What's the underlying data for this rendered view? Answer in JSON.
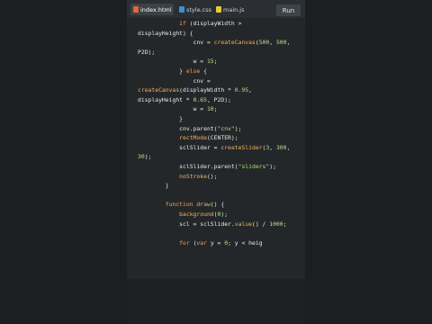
{
  "tabs": [
    {
      "label": "index.html",
      "icon": "html-file-icon",
      "active": true
    },
    {
      "label": "style.css",
      "icon": "css-file-icon",
      "active": false
    },
    {
      "label": "main.js",
      "icon": "js-file-icon",
      "active": false
    }
  ],
  "run_label": "Run",
  "code_lines": [
    [
      {
        "t": "            "
      },
      {
        "t": "if",
        "c": "kw"
      },
      {
        "t": " (displayWidth >"
      }
    ],
    [
      {
        "t": "displayHeight) {"
      }
    ],
    [
      {
        "t": "                "
      },
      {
        "t": "cnv = "
      },
      {
        "t": "createCanvas",
        "c": "fn"
      },
      {
        "t": "("
      },
      {
        "t": "500",
        "c": "num"
      },
      {
        "t": ", "
      },
      {
        "t": "500",
        "c": "num"
      },
      {
        "t": ","
      }
    ],
    [
      {
        "t": "P2D);"
      }
    ],
    [
      {
        "t": "                "
      },
      {
        "t": "w = "
      },
      {
        "t": "15",
        "c": "num"
      },
      {
        "t": ";"
      }
    ],
    [
      {
        "t": "            "
      },
      {
        "t": "} "
      },
      {
        "t": "else",
        "c": "kw"
      },
      {
        "t": " {"
      }
    ],
    [
      {
        "t": "                "
      },
      {
        "t": "cnv ="
      }
    ],
    [
      {
        "t": "createCanvas",
        "c": "fn"
      },
      {
        "t": "(displayWidth * "
      },
      {
        "t": "0.95",
        "c": "num"
      },
      {
        "t": ","
      }
    ],
    [
      {
        "t": "displayHeight * "
      },
      {
        "t": "0.65",
        "c": "num"
      },
      {
        "t": ", P2D);"
      }
    ],
    [
      {
        "t": "                "
      },
      {
        "t": "w = "
      },
      {
        "t": "10",
        "c": "num"
      },
      {
        "t": ";"
      }
    ],
    [
      {
        "t": "            "
      },
      {
        "t": "}"
      }
    ],
    [
      {
        "t": "            "
      },
      {
        "t": "cnv.parent("
      },
      {
        "t": "\"cnv\"",
        "c": "str"
      },
      {
        "t": ");"
      }
    ],
    [
      {
        "t": "            "
      },
      {
        "t": "rectMode",
        "c": "fn"
      },
      {
        "t": "(CENTER);"
      }
    ],
    [
      {
        "t": "            "
      },
      {
        "t": "sclSlider = "
      },
      {
        "t": "createSlider",
        "c": "fn"
      },
      {
        "t": "("
      },
      {
        "t": "3",
        "c": "num"
      },
      {
        "t": ", "
      },
      {
        "t": "300",
        "c": "num"
      },
      {
        "t": ","
      }
    ],
    [
      {
        "t": "30",
        "c": "num"
      },
      {
        "t": ");"
      }
    ],
    [
      {
        "t": "            "
      },
      {
        "t": "sclSlider.parent("
      },
      {
        "t": "\"sliders\"",
        "c": "str"
      },
      {
        "t": ");"
      }
    ],
    [
      {
        "t": "            "
      },
      {
        "t": "noStroke",
        "c": "fn"
      },
      {
        "t": "();"
      }
    ],
    [
      {
        "t": "        "
      },
      {
        "t": "}"
      }
    ],
    [
      {
        "t": ""
      }
    ],
    [
      {
        "t": "        "
      },
      {
        "t": "function",
        "c": "kw"
      },
      {
        "t": " "
      },
      {
        "t": "draw",
        "c": "fn"
      },
      {
        "t": "() {"
      }
    ],
    [
      {
        "t": "            "
      },
      {
        "t": "background",
        "c": "fn"
      },
      {
        "t": "("
      },
      {
        "t": "0",
        "c": "num"
      },
      {
        "t": ");"
      }
    ],
    [
      {
        "t": "            "
      },
      {
        "t": "scl = sclSlider."
      },
      {
        "t": "value",
        "c": "fn"
      },
      {
        "t": "() / "
      },
      {
        "t": "1000",
        "c": "num"
      },
      {
        "t": ";"
      }
    ],
    [
      {
        "t": ""
      }
    ],
    [
      {
        "t": "            "
      },
      {
        "t": "for",
        "c": "kw"
      },
      {
        "t": " ("
      },
      {
        "t": "var",
        "c": "kw"
      },
      {
        "t": " y = "
      },
      {
        "t": "0",
        "c": "num"
      },
      {
        "t": "; y < heig"
      }
    ]
  ]
}
